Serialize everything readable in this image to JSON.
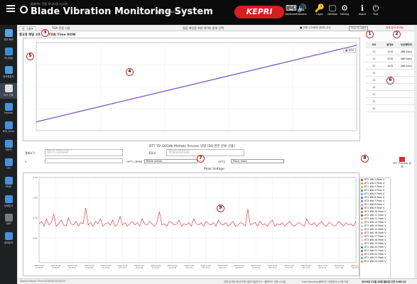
{
  "header": {
    "subtitle": "블레이드 진동 모니터링 시스템",
    "title": "Blade Vibration Monitoring System",
    "version": "version 1.0",
    "checkbox_label": "화면 자동새로고침(5초)",
    "brand": "KEPRI",
    "buttons": [
      {
        "label": "Keyboard",
        "icon": "keyboard-icon",
        "glyph": "⌨"
      },
      {
        "label": "Volume",
        "icon": "volume-icon",
        "glyph": "🔊"
      },
      {
        "label": "Login",
        "icon": "key-icon",
        "glyph": "🔑"
      },
      {
        "label": "Window",
        "icon": "monitor-icon",
        "glyph": "🖵"
      },
      {
        "label": "Setting",
        "icon": "gear-icon",
        "glyph": "⚙"
      },
      {
        "label": "About",
        "icon": "info-icon",
        "glyph": "ℹ"
      },
      {
        "label": "Exit",
        "icon": "exit-icon",
        "glyph": "⏻"
      }
    ]
  },
  "sidebar": [
    {
      "label": "제어 화면",
      "color": "#5aa0e6"
    },
    {
      "label": "모니터링",
      "color": "#3c8dcf"
    },
    {
      "label": "동조화분석",
      "color": "#4a9bd8"
    },
    {
      "label": "BTT 진동",
      "color": "#e0e0e0",
      "active": true
    },
    {
      "label": "Smooth",
      "color": "#4a90d9"
    },
    {
      "label": "BTA_Lines",
      "color": "#4a90d9"
    },
    {
      "label": "SDOF",
      "color": "#4a90d9"
    },
    {
      "label": "CFI",
      "color": "#4a90d9"
    },
    {
      "label": "PEAK",
      "color": "#4a90d9"
    },
    {
      "label": "상태분석",
      "color": "#4a90d9"
    },
    {
      "label": "GAP",
      "color": "#7a7a7a"
    },
    {
      "label": "결과분석",
      "color": "#4a90d9"
    }
  ],
  "tabs": [
    {
      "label": "원 그래프"
    },
    {
      "label": "TOA 전원 시점"
    }
  ],
  "top_panel": {
    "center_caption": "점검 계산을 위한 데이터 범위 선택",
    "right_caption": "■ 전체 1,398개 데이터 수신",
    "button1": "TOA 다시계산",
    "button2": "전체 분석 추가됨",
    "chart_title": "총3개 채널 2초 전채 TOA Time ROW",
    "legend_item": "RPM"
  },
  "side_table": {
    "headers": [
      "CH",
      "날개수",
      "수신데이터"
    ],
    "rows": [
      [
        "11",
        "12개",
        "466 Data"
      ],
      [
        "11",
        "32개",
        "466 Data"
      ],
      [
        "11",
        "34개",
        "466 Data"
      ],
      [
        "11",
        "",
        ""
      ],
      [
        "11",
        "",
        ""
      ],
      [
        "11",
        "",
        ""
      ],
      [
        "11",
        "",
        ""
      ],
      [
        "11",
        "",
        ""
      ],
      [
        "11",
        "",
        ""
      ]
    ]
  },
  "middle": {
    "title": "BTT TD (2018b Matlab) Process 방향 [DS 엔진 분류 선율]",
    "label_start": "결제시각",
    "value_start_1": "마침시간 2019-11-02",
    "value_start_2": "15:17:11:6099999",
    "label_end": "종료시",
    "value_end_1": "마침시간 2019-11-02",
    "value_end_2": "15:18:49:9009999",
    "field_x_label": "X",
    "opt1_label": "OPT1 (RPM)",
    "opt1_value": "Blade sensor",
    "opt2_label": "OPT2",
    "opt2_value": "Rotor mass",
    "process_button": "BTT Process 실행"
  },
  "peak_panel": {
    "title": "Peak Voltage",
    "legend": [
      {
        "name": "BT1 #8L1 Peak V",
        "color": "#d62728"
      },
      {
        "name": "BT1 #8L2 Peak V",
        "color": "#ff7f0e"
      },
      {
        "name": "BT1 #8L3 Peak V",
        "color": "#bcbd22"
      },
      {
        "name": "BT1 #8L4 Peak V",
        "color": "#2ca02c"
      },
      {
        "name": "BT1 #8L5 Peak V",
        "color": "#17becf"
      },
      {
        "name": "BT1 #8L6 Peak V",
        "color": "#1f77b4"
      },
      {
        "name": "BT1 #8L7 Peak V",
        "color": "#9467bd"
      },
      {
        "name": "BT1 #8L8 Peak V",
        "color": "#e377c2"
      },
      {
        "name": "BT1 #8L9 Peak V",
        "color": "#8c564b"
      },
      {
        "name": "BT1 #8L10 Peak V",
        "color": "#7f7f7f"
      },
      {
        "name": "BT1 #8L11 Peak V",
        "color": "#d62728"
      },
      {
        "name": "BT1 #8L12 Peak V",
        "color": "#ff9896"
      },
      {
        "name": "BT1 #8L13 Peak V",
        "color": "#98df8a"
      },
      {
        "name": "BT1 #8L14 Peak V",
        "color": "#aec7e8"
      },
      {
        "name": "BT1 #8L15 Peak V",
        "color": "#c5b0d5"
      },
      {
        "name": "BT1 #8L16 Peak V",
        "color": "#c49c94"
      },
      {
        "name": "BT1 #8L17 Peak V",
        "color": "#f7b6d2"
      },
      {
        "name": "BT1 #8L18 Peak V",
        "color": "#dbdb8d"
      },
      {
        "name": "BT1 #8L19 Peak V",
        "color": "#9edae5"
      },
      {
        "name": "BT1 #8L20 Peak V",
        "color": "#1f77b4"
      },
      {
        "name": "BT1 #8L21 Peak V",
        "color": "#2ca02c"
      },
      {
        "name": "BT1 #8L22 Peak V",
        "color": "#e377c2"
      },
      {
        "name": "BT1 #8L23 Peak V",
        "color": "#17becf"
      },
      {
        "name": "BT1 #8L24 Peak V",
        "color": "#ff7f0e"
      }
    ]
  },
  "status": {
    "left": "Display Result Time 00:00:00.00:00:25",
    "item1": "전체 분석등 위(연구원) 발전기술연구소 · 블레이드 진동 시스템",
    "item2": "Free Standing 블레이드 진동분석시스템 가동",
    "datetime": "2019년 12월 18일 월요일 오전 4:58:12"
  },
  "badges": [
    "1",
    "2",
    "3",
    "4",
    "5",
    "6",
    "7",
    "8",
    "9"
  ],
  "chart_data": [
    {
      "type": "line",
      "title": "총3개 채널 2초 전채 TOA Time ROW",
      "series": [
        {
          "name": "RPM",
          "color": "#7b5bc4",
          "x": [
            0,
            1
          ],
          "y": [
            0.1,
            0.97
          ]
        }
      ],
      "xlim": [
        0,
        1
      ],
      "ylim": [
        0,
        1
      ],
      "legend": "top-right"
    },
    {
      "type": "line",
      "title": "Peak Voltage",
      "ylim": [
        0.3,
        1.0
      ],
      "y_ticks": [
        "0.50",
        "0.60",
        "0.70",
        "0.80"
      ],
      "x_ticks": [
        "2019-11-02 15:16:53",
        "2019-11-02 15:16:55",
        "2019-11-02 15:16:57",
        "2019-11-02 15:16:59",
        "2019-11-02 15:17:01",
        "2019-11-02 15:17:03",
        "2019-11-02 15:17:05",
        "2019-11-02 15:17:07",
        "2019-11-02 15:17:09",
        "2019-11-02 15:17:11",
        "2019-11-02 15:17:13",
        "2019-11-02 15:17:15",
        "2019-11-02 15:17:17",
        "2019-11-02 15:17:19",
        "2019-11-02 15:17:21",
        "2019-11-02 15:17:23",
        "2019-11-02 15:17:25",
        "2019-11-02 15:17:27",
        "2019-11-02 15:17:29",
        "2019-11-02 15:17:31"
      ],
      "series": [
        {
          "name": "BT1 #8L1 Peak V",
          "color": "#d62728",
          "y": [
            0.62,
            0.64,
            0.6,
            0.66,
            0.61,
            0.63,
            0.7,
            0.6,
            0.62,
            0.65,
            0.61,
            0.6,
            0.67,
            0.62,
            0.61,
            0.64,
            0.6,
            0.63,
            0.62,
            0.75,
            0.61,
            0.63,
            0.6,
            0.64,
            0.62,
            0.66,
            0.6,
            0.62,
            0.63,
            0.61,
            0.65,
            0.6,
            0.62,
            0.68,
            0.61,
            0.63,
            0.6,
            0.62,
            0.64,
            0.61,
            0.63,
            0.6,
            0.66,
            0.62,
            0.61,
            0.64,
            0.62,
            0.6,
            0.63,
            0.72,
            0.61,
            0.62,
            0.6,
            0.64,
            0.63,
            0.61,
            0.62,
            0.65,
            0.6,
            0.62,
            0.61,
            0.63,
            0.6,
            0.66,
            0.62,
            0.61,
            0.63,
            0.6,
            0.64,
            0.62,
            0.61,
            0.63,
            0.6,
            0.65,
            0.62,
            0.61,
            0.63,
            0.6,
            0.62,
            0.64,
            0.6,
            0.61,
            0.63,
            0.62,
            0.6,
            0.74,
            0.61,
            0.62,
            0.63,
            0.6,
            0.64,
            0.61,
            0.62,
            0.6,
            0.63,
            0.65,
            0.6,
            0.62,
            0.61,
            0.63,
            0.6,
            0.62,
            0.64,
            0.61,
            0.6,
            0.62,
            0.63,
            0.61,
            0.6,
            0.66,
            0.62,
            0.61,
            0.63,
            0.6,
            0.62,
            0.64,
            0.61,
            0.6,
            0.63,
            0.62,
            0.6,
            0.61,
            0.64,
            0.62,
            0.6,
            0.63,
            0.61,
            0.62,
            0.6,
            0.64
          ]
        }
      ]
    }
  ]
}
